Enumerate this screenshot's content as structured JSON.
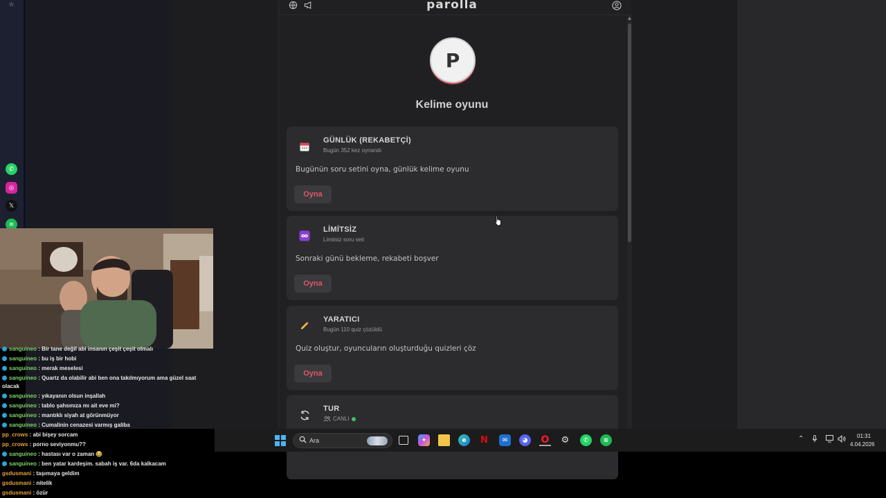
{
  "site": {
    "logo": "parolla",
    "avatar_letter": "P",
    "title": "Kelime oyunu"
  },
  "cards": [
    {
      "icon": "calendar-icon",
      "title": "GÜNLÜK (REKABETÇİ)",
      "subtitle": "Bugün 352 kez oynandı",
      "description": "Bugünün soru setini oyna, günlük kelime oyunu",
      "button": "Oyna"
    },
    {
      "icon": "infinity-icon",
      "title": "LİMİTSİZ",
      "subtitle": "Limitsiz soru seti",
      "description": "Sonraki günü bekleme, rekabeti boşver",
      "button": "Oyna"
    },
    {
      "icon": "pencil-icon",
      "title": "YARATICI",
      "subtitle": "Bugün 110 quiz çözüldü",
      "description": "Quiz oluştur, oyuncuların oluşturduğu quizleri çöz",
      "button": "Oyna"
    },
    {
      "icon": "refresh-icon",
      "title": "TUR",
      "subtitle": "CANLI"
    }
  ],
  "chat": [
    {
      "user": "sanguineo",
      "text": "Bir tane değil abi insanın çeşit çeşit olmalı",
      "color": "#7fd36a",
      "badge": true
    },
    {
      "user": "sanguineo",
      "text": "bu iş bir hobi",
      "color": "#7fd36a",
      "badge": true
    },
    {
      "user": "sanguineo",
      "text": "merak meselesi",
      "color": "#7fd36a",
      "badge": true
    },
    {
      "user": "sanguineo",
      "text": "Quartz da olabilir abi ben ona takılmıyorum ama güzel saat",
      "color": "#7fd36a",
      "badge": true
    },
    {
      "user": "",
      "text": "olacak",
      "color": "#e8e8e8",
      "badge": false
    },
    {
      "user": "sanguineo",
      "text": "yıkayanın olsun inşallah",
      "color": "#7fd36a",
      "badge": true
    },
    {
      "user": "sanguineo",
      "text": "tablo şahsınıza mı ait eve mi?",
      "color": "#7fd36a",
      "badge": true
    },
    {
      "user": "sanguineo",
      "text": "mantıklı siyah at görünmüyor",
      "color": "#7fd36a",
      "badge": true
    },
    {
      "user": "sanguineo",
      "text": "Cumalinin cenazesi varmış galiba",
      "color": "#7fd36a",
      "badge": true
    },
    {
      "user": "pp_crows",
      "text": "abi bişey sorcam",
      "color": "#e6a23c",
      "badge": false
    },
    {
      "user": "pp_crows",
      "text": "porno seviyonmu??",
      "color": "#e6a23c",
      "badge": false
    },
    {
      "user": "sanguineo",
      "text": "hastası var o zaman 😂",
      "color": "#7fd36a",
      "badge": true
    },
    {
      "user": "sanguineo",
      "text": "ben yatar kardeşim. sabah iş var. 6da kalkacam",
      "color": "#7fd36a",
      "badge": true
    },
    {
      "user": "gsdusmani",
      "text": "taşımaya geldim",
      "color": "#e6a23c",
      "badge": false
    },
    {
      "user": "gsdusmani",
      "text": "nitelik",
      "color": "#e6a23c",
      "badge": false
    },
    {
      "user": "gsdusmani",
      "text": "özür",
      "color": "#e6a23c",
      "badge": false
    }
  ],
  "taskbar": {
    "search_label": "Ara",
    "time": "01:31",
    "date": "4.04.2026"
  }
}
